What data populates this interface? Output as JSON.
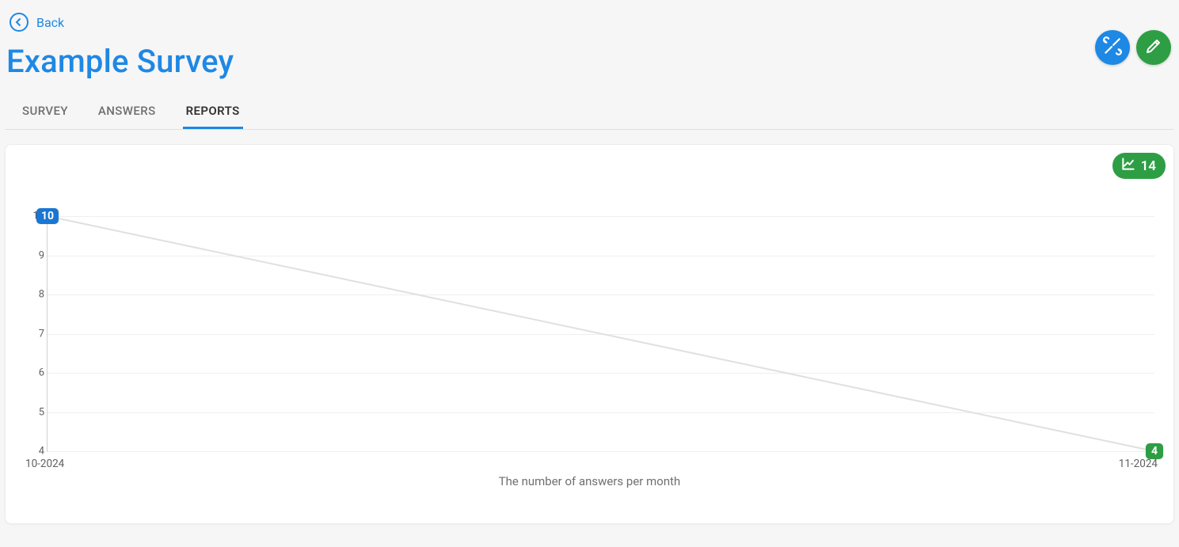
{
  "header": {
    "back_label": "Back",
    "title": "Example Survey"
  },
  "tabs": [
    {
      "label": "SURVEY",
      "active": false
    },
    {
      "label": "ANSWERS",
      "active": false
    },
    {
      "label": "REPORTS",
      "active": true
    }
  ],
  "card": {
    "pill_value": "14",
    "caption": "The number of answers per month"
  },
  "chart_data": {
    "type": "line",
    "categories": [
      "10-2024",
      "11-2024"
    ],
    "values": [
      10,
      4
    ],
    "data_labels": [
      10,
      4
    ],
    "title": "The number of answers per month",
    "xlabel": "",
    "ylabel": "",
    "y_ticks": [
      4,
      5,
      6,
      7,
      8,
      9,
      10
    ],
    "ylim": [
      4,
      10
    ],
    "point_colors": [
      "#1976d2",
      "#2e9e44"
    ],
    "line_color": "#e0e0e0",
    "grid": true
  }
}
